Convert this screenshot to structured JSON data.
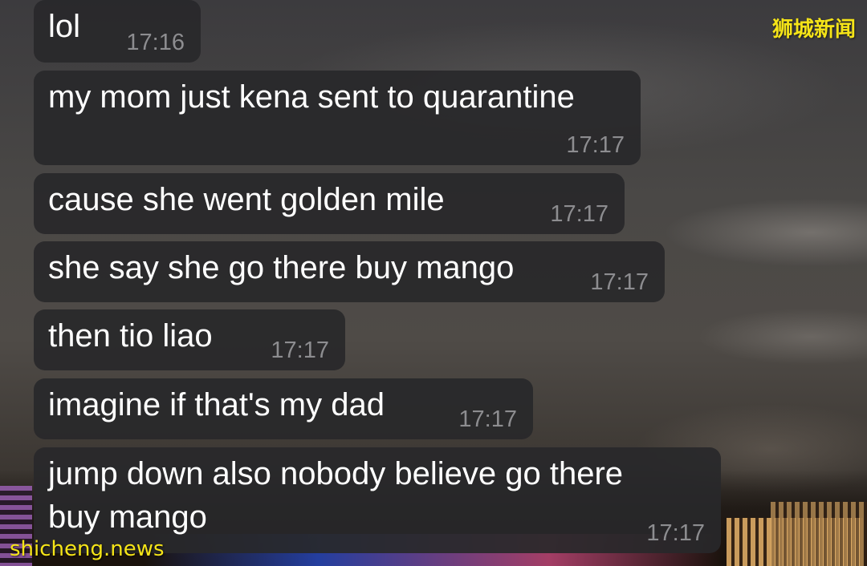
{
  "watermarks": {
    "top_right": "狮城新闻",
    "bottom_left": "shicheng.news"
  },
  "messages": [
    {
      "text": "lol",
      "time": "17:16"
    },
    {
      "text": "my mom just kena sent to quarantine",
      "time": "17:17"
    },
    {
      "text": "cause she went golden mile",
      "time": "17:17"
    },
    {
      "text": "she say she go there buy mango",
      "time": "17:17"
    },
    {
      "text": "then tio liao",
      "time": "17:17"
    },
    {
      "text": "imagine if that's my dad",
      "time": "17:17"
    },
    {
      "text": "jump down also nobody believe go there\nbuy mango",
      "time": "17:17"
    }
  ],
  "colors": {
    "bubble": "#28282a",
    "text": "#ffffff",
    "timestamp": "#8d8d90",
    "watermark": "#f5e418"
  }
}
